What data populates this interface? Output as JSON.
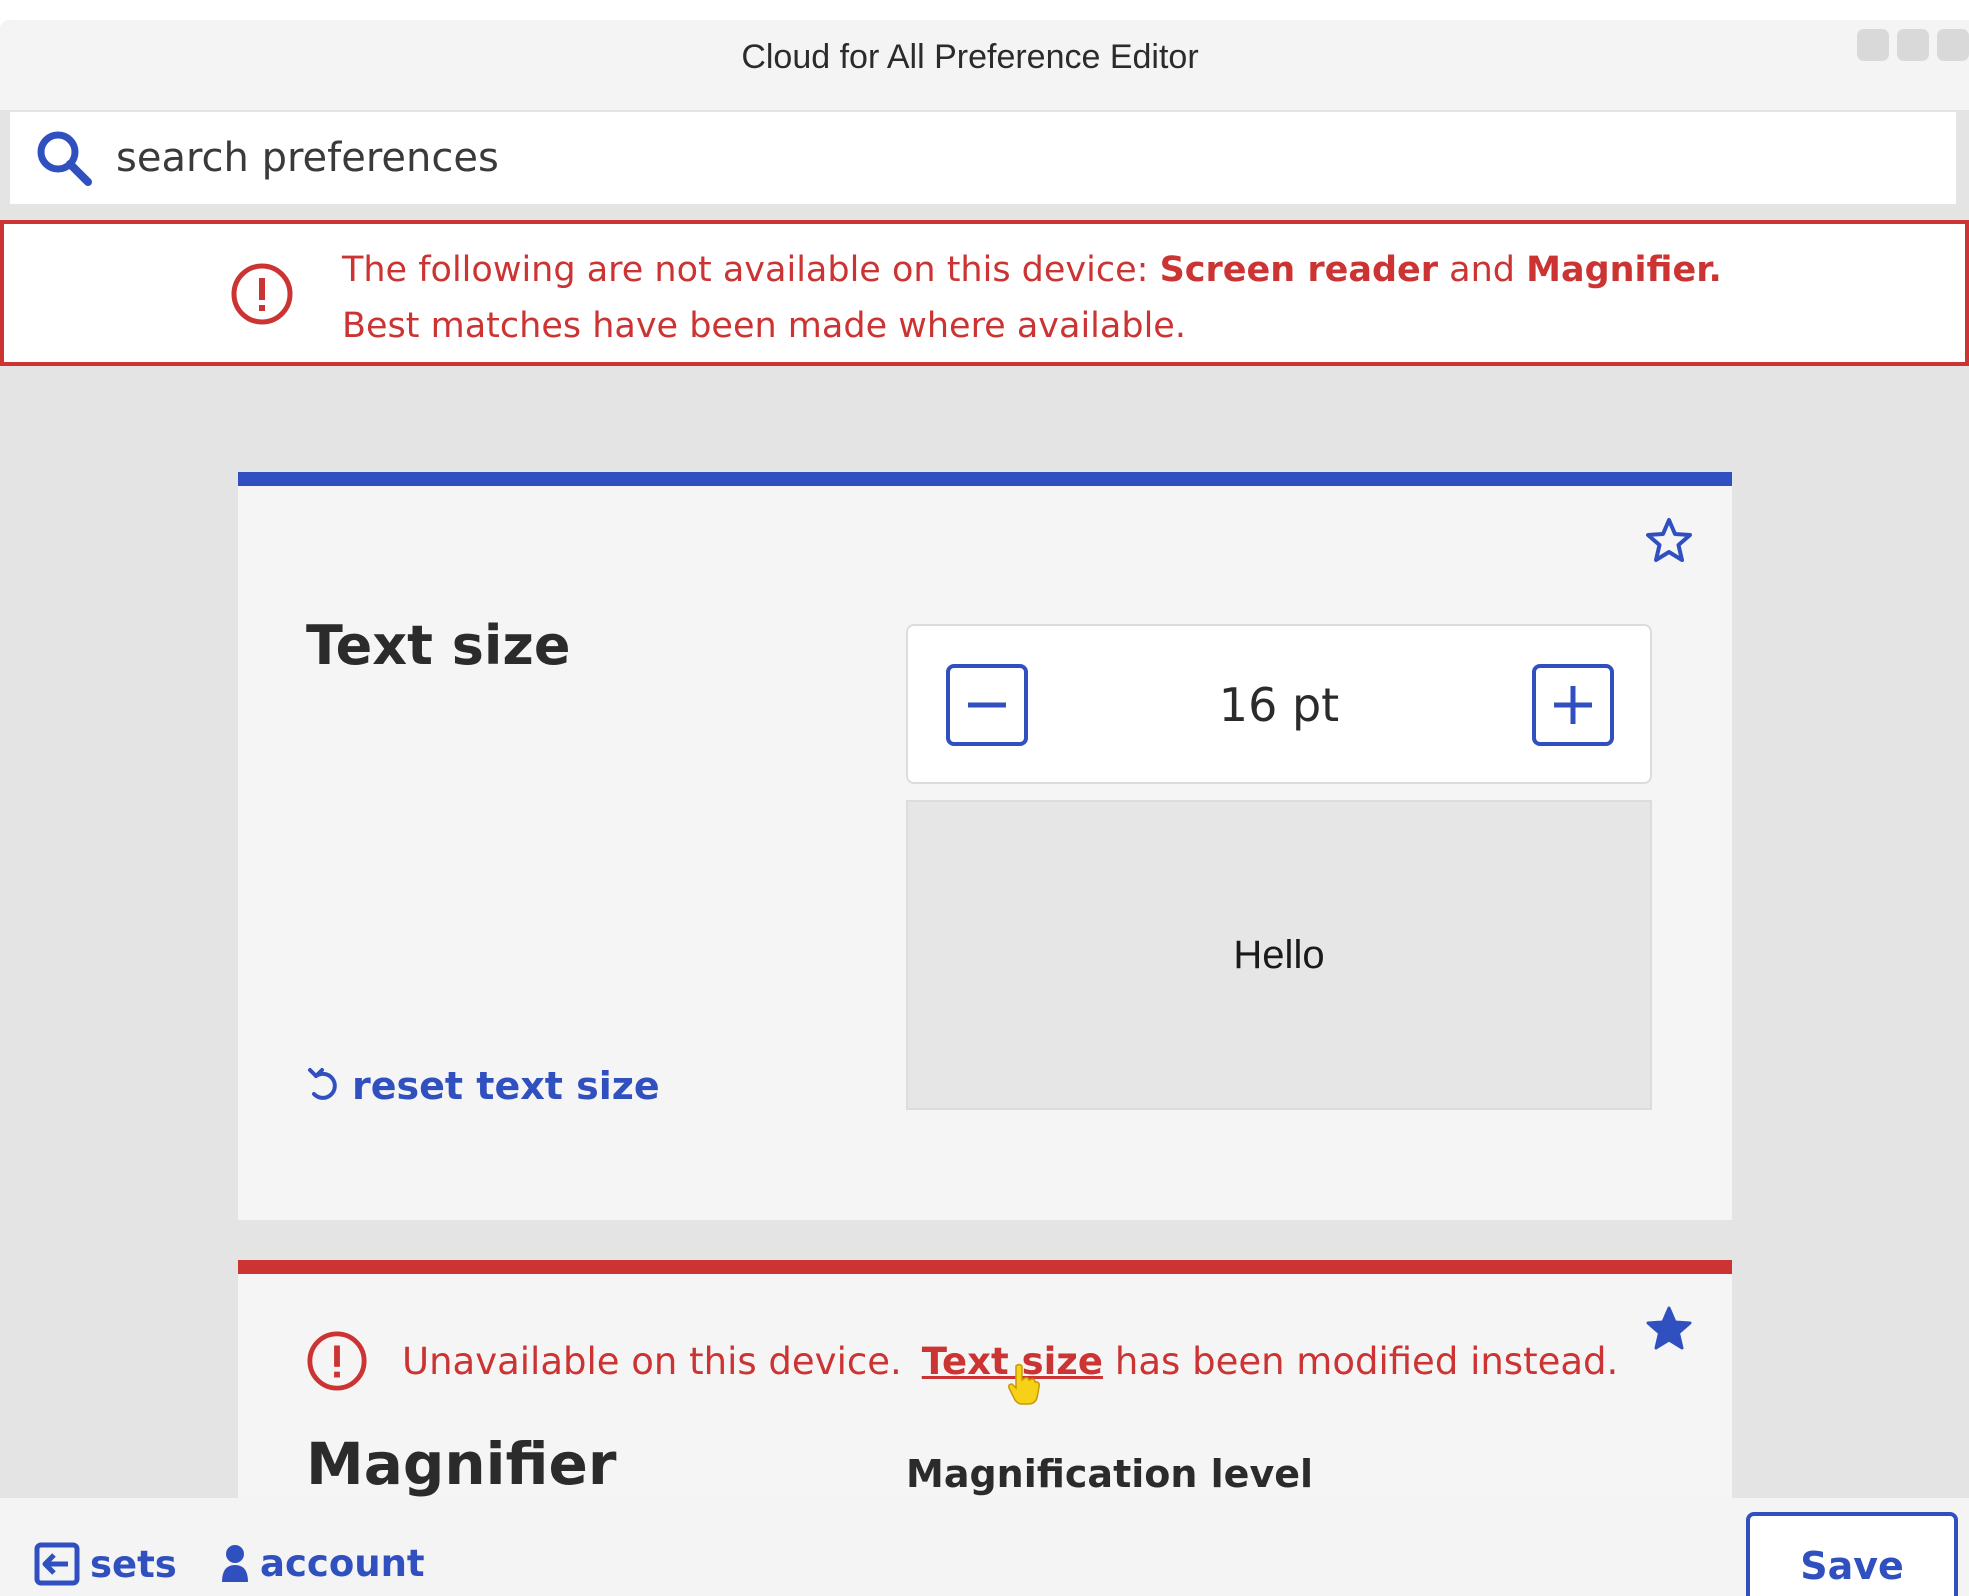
{
  "window": {
    "title": "Cloud for All Preference Editor"
  },
  "search": {
    "placeholder": "search preferences",
    "icon": "search-icon"
  },
  "banner": {
    "prefix": "The following are not available on this device: ",
    "item1": "Screen reader",
    "joiner": " and ",
    "item2": "Magnifier.",
    "line2": "Best matches have been made where available.",
    "color": "#cc3333"
  },
  "text_size_card": {
    "title": "Text size",
    "value": "16 pt",
    "preview": "Hello",
    "reset_label": "reset text size",
    "accent": "#3050c0",
    "starred": false
  },
  "magnifier_card": {
    "warning_prefix": "Unavailable on this device.",
    "warning_link": "Text size",
    "warning_suffix": "has been modified instead.",
    "title": "Magnifier",
    "field_label": "Magnification level",
    "accent": "#cc3333",
    "starred": true
  },
  "footer": {
    "sets_label": "sets",
    "account_label": "account",
    "save_label": "Save"
  }
}
